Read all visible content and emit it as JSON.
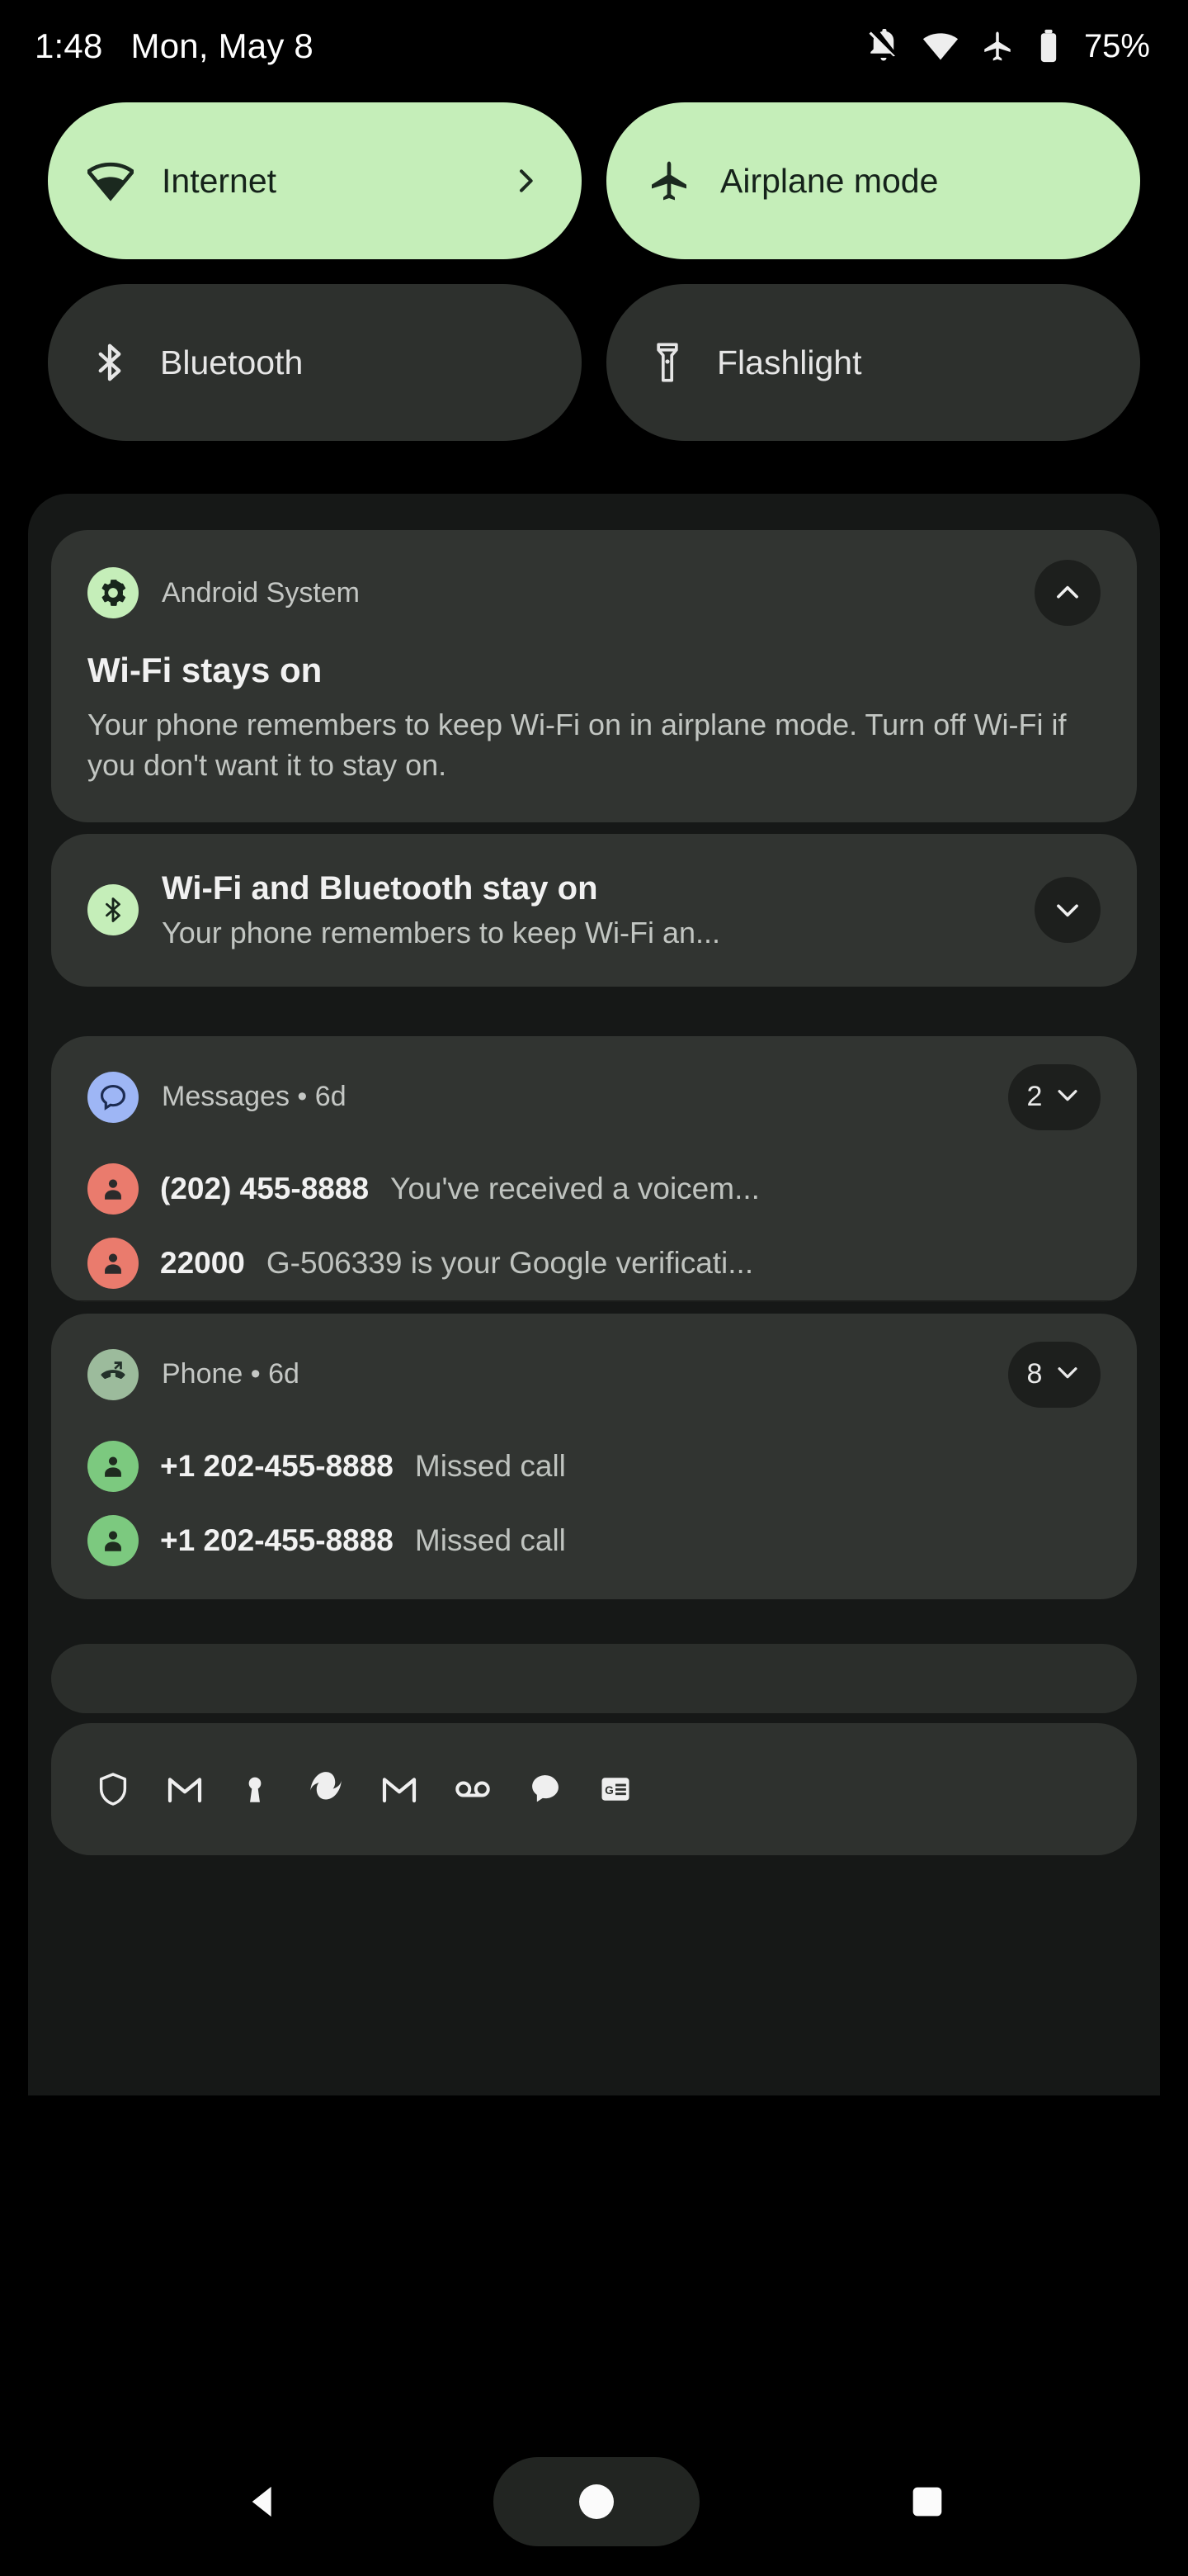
{
  "status_bar": {
    "time": "1:48",
    "date": "Mon, May 8",
    "battery_percent": "75%",
    "icons": [
      "notifications-off-icon",
      "wifi-icon",
      "airplane-icon",
      "battery-icon"
    ]
  },
  "quick_settings": {
    "tiles": [
      {
        "label": "Internet",
        "icon": "wifi-icon",
        "state": "on",
        "has_chevron": true
      },
      {
        "label": "Airplane mode",
        "icon": "airplane-icon",
        "state": "on",
        "has_chevron": false
      },
      {
        "label": "Bluetooth",
        "icon": "bluetooth-icon",
        "state": "off",
        "has_chevron": false
      },
      {
        "label": "Flashlight",
        "icon": "flashlight-icon",
        "state": "off",
        "has_chevron": false
      }
    ]
  },
  "notifications": {
    "android_system": {
      "app_name": "Android System",
      "app_icon": "settings-gear-icon",
      "title": "Wi-Fi stays on",
      "body": "Your phone remembers to keep Wi-Fi on in airplane mode. Turn off Wi-Fi if you don't want it to stay on.",
      "expander_icon": "chevron-up-icon"
    },
    "wifi_bluetooth": {
      "app_icon": "bluetooth-icon",
      "title": "Wi-Fi and Bluetooth stay on",
      "body": "Your phone remembers to keep Wi-Fi an...",
      "expander_icon": "chevron-down-icon"
    },
    "messages_group": {
      "app_name": "Messages",
      "app_icon": "messages-chat-icon",
      "timestamp": "6d",
      "separator": "•",
      "count": "2",
      "expander_icon": "chevron-down-icon",
      "items": [
        {
          "sender": "(202) 455-8888",
          "preview": "You've received a voicem...",
          "avatar": "person-icon"
        },
        {
          "sender": "22000",
          "preview": "G-506339 is your Google verificati...",
          "avatar": "person-icon"
        }
      ]
    },
    "phone_group": {
      "app_name": "Phone",
      "app_icon": "missed-call-icon",
      "timestamp": "6d",
      "separator": "•",
      "count": "8",
      "expander_icon": "chevron-down-icon",
      "items": [
        {
          "sender": "+1 202-455-8888",
          "preview": "Missed call",
          "avatar": "person-icon"
        },
        {
          "sender": "+1 202-455-8888",
          "preview": "Missed call",
          "avatar": "person-icon"
        }
      ]
    }
  },
  "app_tray": {
    "icons": [
      "shield-icon",
      "gmail-icon",
      "keyhole-icon",
      "photos-shutter-icon",
      "gmail-icon",
      "voicemail-icon",
      "chat-bubble-icon",
      "google-news-icon"
    ]
  },
  "nav_bar": {
    "back": "back-triangle-icon",
    "home": "home-circle-icon",
    "recents": "recents-square-icon"
  },
  "colors": {
    "tile_on_bg": "#c5eeb9",
    "tile_off_bg": "#2d302d",
    "card_bg": "#313431",
    "shade_bg": "#161817",
    "avatar_red": "#ea7b6d",
    "avatar_green": "#7cc97f",
    "messages_icon_bg": "#9eb6f5"
  }
}
